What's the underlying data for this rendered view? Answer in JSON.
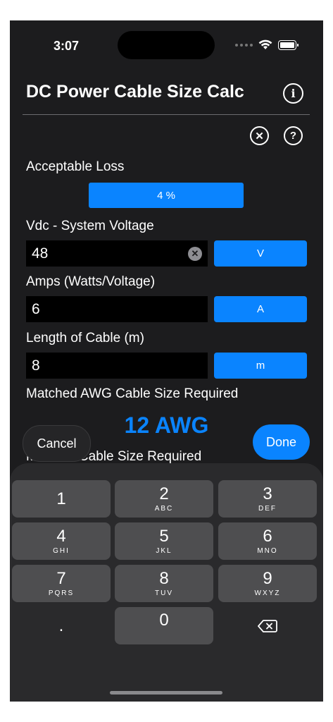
{
  "status": {
    "time": "3:07"
  },
  "header": {
    "title": "DC Power Cable Size Calc",
    "info_icon": "info-circle-icon"
  },
  "toolbar": {
    "clear_icon": "clear-circle-icon",
    "help_icon": "help-circle-icon"
  },
  "loss": {
    "label": "Acceptable Loss",
    "value": "4 %"
  },
  "voltage": {
    "label": "Vdc - System Voltage",
    "value": "48",
    "unit": "V"
  },
  "amps": {
    "label": "Amps (Watts/Voltage)",
    "value": "6",
    "unit": "A"
  },
  "length": {
    "label": "Length of Cable (m)",
    "value": "8",
    "unit": "m"
  },
  "awg": {
    "label": "Matched AWG Cable Size Required",
    "value": "12 AWG"
  },
  "mm2": {
    "label": "M   mm² Cable Size Required"
  },
  "accessory": {
    "cancel": "Cancel",
    "done": "Done"
  },
  "keypad": {
    "k1": {
      "num": "1",
      "letters": ""
    },
    "k2": {
      "num": "2",
      "letters": "ABC"
    },
    "k3": {
      "num": "3",
      "letters": "DEF"
    },
    "k4": {
      "num": "4",
      "letters": "GHI"
    },
    "k5": {
      "num": "5",
      "letters": "JKL"
    },
    "k6": {
      "num": "6",
      "letters": "MNO"
    },
    "k7": {
      "num": "7",
      "letters": "PQRS"
    },
    "k8": {
      "num": "8",
      "letters": "TUV"
    },
    "k9": {
      "num": "9",
      "letters": "WXYZ"
    },
    "k0": {
      "num": "0",
      "letters": ""
    },
    "decimal": ".",
    "delete_icon": "backspace-icon"
  },
  "colors": {
    "accent": "#0a84ff",
    "background": "#1c1c1e",
    "field": "#000000",
    "key": "#4e4e50"
  }
}
